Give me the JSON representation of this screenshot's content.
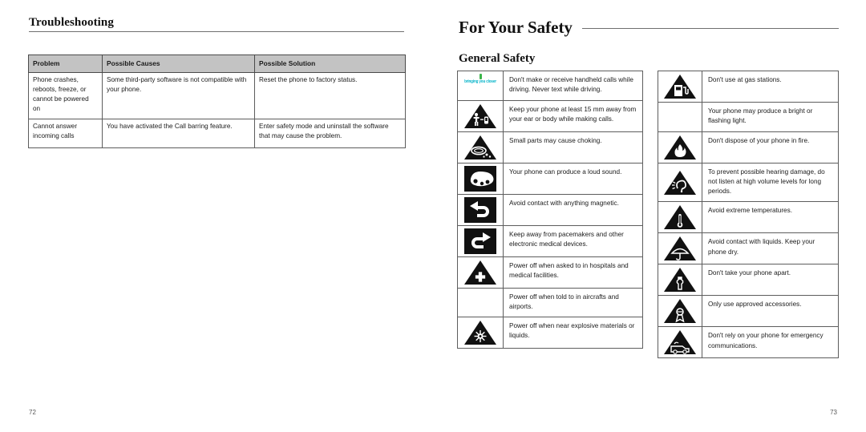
{
  "left_page": {
    "heading": "Troubleshooting",
    "folio": "72",
    "table": {
      "headers": [
        "Problem",
        "Possible Causes",
        "Possible Solution"
      ],
      "rows": [
        {
          "problem": "Phone crashes, reboots, freeze, or cannot be powered on",
          "cause": "Some third-party software is not compatible with your phone.",
          "solution": "Reset the phone to factory status."
        },
        {
          "problem": "Cannot answer incoming calls",
          "cause": "You have activated the Call barring feature.",
          "solution": "Enter safety mode and uninstall the software that may cause the problem."
        }
      ]
    }
  },
  "right_page": {
    "heading": "For Your Safety",
    "section_heading": "General Safety",
    "folio": "73",
    "logo": {
      "text": "bringing you closer",
      "text_color": "#00b3c8",
      "spark_color": "#3bb54a"
    },
    "safety_left_column": [
      {
        "icon": "brand-logo-icon",
        "text": "Don't make or receive handheld calls while driving. Never text while driving."
      },
      {
        "icon": "body-distance-warning-icon",
        "text": "Keep your phone at least 15 mm away from your ear or body while making calls."
      },
      {
        "icon": "choking-hazard-warning-icon",
        "text": "Small parts may cause choking."
      },
      {
        "icon": "loud-sound-icon",
        "text": "Your phone can produce a loud sound."
      },
      {
        "icon": "magnetic-left-arrow-icon",
        "text": "Avoid contact with anything magnetic."
      },
      {
        "icon": "magnetic-right-arrow-icon",
        "text": "Keep away from pacemakers and other electronic medical devices."
      },
      {
        "icon": "hospital-warning-icon",
        "text": "Power off when asked to in hospitals and medical facilities."
      },
      {
        "icon": "no-icon",
        "text": "Power off when told to in aircrafts and airports."
      },
      {
        "icon": "explosive-warning-icon",
        "text": "Power off when near explosive materials or liquids."
      }
    ],
    "safety_right_column": [
      {
        "icon": "gas-station-warning-icon",
        "text": "Don't use at gas stations."
      },
      {
        "icon": "no-icon",
        "text": "Your phone may produce a bright or flashing light."
      },
      {
        "icon": "fire-warning-icon",
        "text": "Don't dispose of your phone in fire."
      },
      {
        "icon": "hearing-damage-warning-icon",
        "text": "To prevent possible hearing damage, do not listen at high volume levels for long periods."
      },
      {
        "icon": "temperature-warning-icon",
        "text": "Avoid extreme temperatures."
      },
      {
        "icon": "liquid-warning-icon",
        "text": "Avoid contact with liquids. Keep your phone dry."
      },
      {
        "icon": "do-not-disassemble-icon",
        "text": "Don't take your phone apart."
      },
      {
        "icon": "approved-accessories-icon",
        "text": "Only use approved accessories."
      },
      {
        "icon": "emergency-vehicle-icon",
        "text": "Don't rely on your phone for emergency communications."
      }
    ]
  }
}
